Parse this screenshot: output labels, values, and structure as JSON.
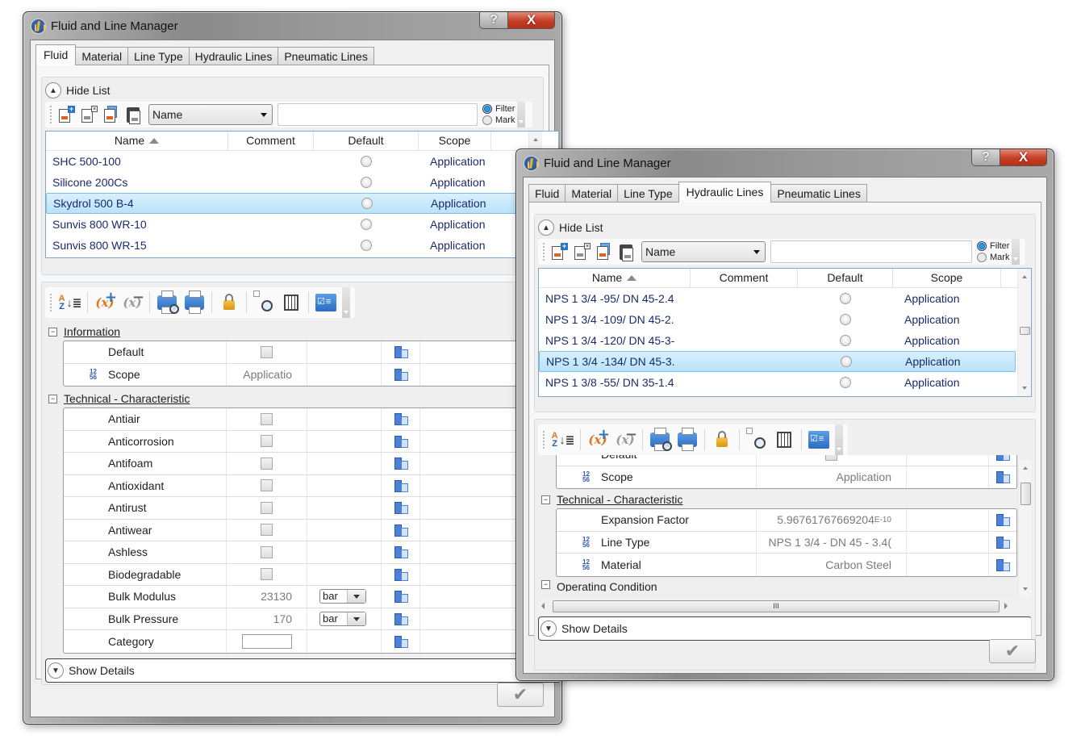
{
  "window1": {
    "title": "Fluid and Line Manager",
    "caption": {
      "help": "?",
      "close": "X"
    },
    "tabs": [
      {
        "label": "Fluid",
        "active": true
      },
      {
        "label": "Material",
        "active": false
      },
      {
        "label": "Line Type",
        "active": false
      },
      {
        "label": "Hydraulic Lines",
        "active": false
      },
      {
        "label": "Pneumatic Lines",
        "active": false
      }
    ],
    "hide_list_label": "Hide List",
    "list_toolbar": {
      "icons": [
        "new-item-icon",
        "delete-item-icon",
        "copy-item-icon",
        "paste-item-icon"
      ],
      "field_combo": "Name",
      "search_value": "",
      "filter_label": "Filter",
      "mark_label": "Mark",
      "selected_mode": "Filter"
    },
    "columns": [
      "Name",
      "Comment",
      "Default",
      "Scope"
    ],
    "rows": [
      {
        "name": "SHC 500-100",
        "comment": "",
        "default": false,
        "scope": "Application",
        "selected": false
      },
      {
        "name": "Silicone 200Cs",
        "comment": "",
        "default": false,
        "scope": "Application",
        "selected": false
      },
      {
        "name": "Skydrol 500 B-4",
        "comment": "",
        "default": false,
        "scope": "Application",
        "selected": true
      },
      {
        "name": "Sunvis 800 WR-10",
        "comment": "",
        "default": false,
        "scope": "Application",
        "selected": false
      },
      {
        "name": "Sunvis 800 WR-15",
        "comment": "",
        "default": false,
        "scope": "Application",
        "selected": false
      }
    ],
    "property_toolbar_icons": [
      "sort-alpha-icon",
      "add-variable-icon",
      "remove-variable-icon",
      "print-preview-icon",
      "print-icon",
      "lock-icon",
      "find-icon",
      "calculator-icon",
      "checklist-icon"
    ],
    "categories": [
      {
        "label": "Information",
        "props": [
          {
            "name": "Default",
            "type": "checkbox",
            "checked": false
          },
          {
            "name": "Scope",
            "type": "text",
            "value": "Applicatio",
            "numeric_icon": true
          }
        ]
      },
      {
        "label": "Technical - Characteristic",
        "props": [
          {
            "name": "Antiair",
            "type": "checkbox",
            "checked": false
          },
          {
            "name": "Anticorrosion",
            "type": "checkbox",
            "checked": false
          },
          {
            "name": "Antifoam",
            "type": "checkbox",
            "checked": false
          },
          {
            "name": "Antioxidant",
            "type": "checkbox",
            "checked": false
          },
          {
            "name": "Antirust",
            "type": "checkbox",
            "checked": false
          },
          {
            "name": "Antiwear",
            "type": "checkbox",
            "checked": false
          },
          {
            "name": "Ashless",
            "type": "checkbox",
            "checked": false
          },
          {
            "name": "Biodegradable",
            "type": "checkbox",
            "checked": false
          },
          {
            "name": "Bulk Modulus",
            "type": "number",
            "value": "23130",
            "unit": "bar"
          },
          {
            "name": "Bulk Pressure",
            "type": "number",
            "value": "170",
            "unit": "bar"
          },
          {
            "name": "Category",
            "type": "textbox",
            "value": ""
          }
        ]
      }
    ],
    "show_details_label": "Show Details",
    "ok_label": "✔"
  },
  "window2": {
    "title": "Fluid and Line Manager",
    "caption": {
      "help": "?",
      "close": "X"
    },
    "tabs": [
      {
        "label": "Fluid",
        "active": false
      },
      {
        "label": "Material",
        "active": false
      },
      {
        "label": "Line Type",
        "active": false
      },
      {
        "label": "Hydraulic Lines",
        "active": true
      },
      {
        "label": "Pneumatic Lines",
        "active": false
      }
    ],
    "hide_list_label": "Hide List",
    "list_toolbar": {
      "field_combo": "Name",
      "search_value": "",
      "filter_label": "Filter",
      "mark_label": "Mark",
      "selected_mode": "Filter"
    },
    "columns": [
      "Name",
      "Comment",
      "Default",
      "Scope"
    ],
    "rows": [
      {
        "name": "NPS 1 3/4 -95/ DN 45-2.4",
        "comment": "",
        "default": false,
        "scope": "Application",
        "selected": false
      },
      {
        "name": "NPS 1 3/4 -109/ DN 45-2.",
        "comment": "",
        "default": false,
        "scope": "Application",
        "selected": false
      },
      {
        "name": "NPS 1 3/4 -120/ DN 45-3-",
        "comment": "",
        "default": false,
        "scope": "Application",
        "selected": false
      },
      {
        "name": "NPS 1 3/4 -134/ DN 45-3.",
        "comment": "",
        "default": false,
        "scope": "Application",
        "selected": true
      },
      {
        "name": "NPS 1 3/8 -55/ DN 35-1.4",
        "comment": "",
        "default": false,
        "scope": "Application",
        "selected": false
      }
    ],
    "partial_prop_top": "Default",
    "info_props": [
      {
        "name": "Scope",
        "value": "Application"
      }
    ],
    "category_label": "Technical - Characteristic",
    "tech_props": [
      {
        "name": "Expansion Factor",
        "value": "5.96761767669204",
        "exponent": "E-10",
        "numeric_icon": false
      },
      {
        "name": "Line Type",
        "value": "NPS 1 3/4 - DN 45 - 3.4(",
        "numeric_icon": true
      },
      {
        "name": "Material",
        "value": "Carbon Steel",
        "numeric_icon": true
      }
    ],
    "partial_category": "Operating Condition",
    "hscroll_grip": "III",
    "show_details_label": "Show Details",
    "ok_label": "✔"
  }
}
